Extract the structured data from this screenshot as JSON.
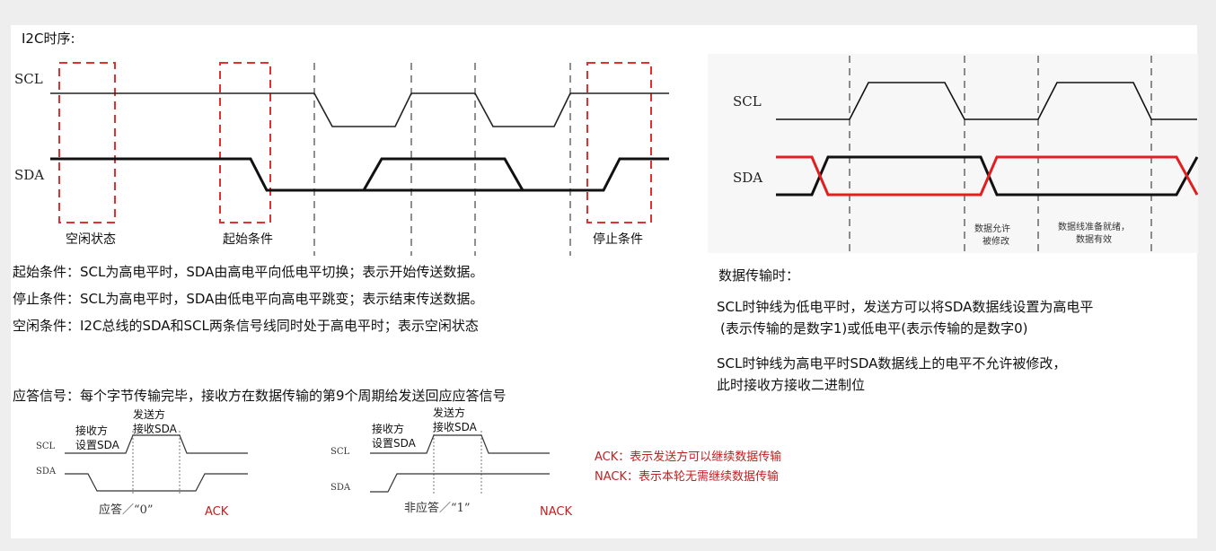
{
  "title": "I2C时序:",
  "main_diagram": {
    "scl_label": "SCL",
    "sda_label": "SDA",
    "idle_label": "空闲状态",
    "start_label": "起始条件",
    "stop_label": "停止条件",
    "colors": {
      "signal": "#222222",
      "highlight_box": "#e03030",
      "divider": "#444444"
    }
  },
  "descriptions": [
    "起始条件：SCL为高电平时，SDA由高电平向低电平切换；表示开始传送数据。",
    "停止条件：SCL为高电平时，SDA由低电平向高电平跳变；表示结束传送数据。",
    "空闲条件：I2C总线的SDA和SCL两条信号线同时处于高电平时；表示空闲状态"
  ],
  "transfer_diagram": {
    "scl_label": "SCL",
    "sda_label": "SDA",
    "note_modify_line1": "数据允许",
    "note_modify_line2": "被修改",
    "note_ready_line1": "数据线准备就绪，",
    "note_ready_line2": "数据有效",
    "colors": {
      "black": "#111111",
      "red": "#e02020"
    }
  },
  "transfer_text": {
    "heading": "数据传输时：",
    "para1_line1": "SCL时钟线为低电平时，发送方可以将SDA数据线设置为高电平",
    "para1_line2": "(表示传输的是数字1)或低电平(表示传输的是数字0)",
    "para2_line1": "SCL时钟线为高电平时SDA数据线上的电平不允许被修改，",
    "para2_line2": "此时接收方接收二进制位"
  },
  "ack_heading": "应答信号：每个字节传输完毕，接收方在数据传输的第9个周期给发送回应应答信号",
  "ack_diagram": {
    "scl_label": "SCL",
    "sda_label": "SDA",
    "receiver_line1": "接收方",
    "receiver_line2": "设置SDA",
    "sender_line1": "发送方",
    "sender_line2": "接收SDA",
    "caption": "应答／“0”",
    "tag": "ACK"
  },
  "nack_diagram": {
    "scl_label": "SCL",
    "sda_label": "SDA",
    "receiver_line1": "接收方",
    "receiver_line2": "设置SDA",
    "sender_line1": "发送方",
    "sender_line2": "接收SDA",
    "caption": "非应答／“1”",
    "tag": "NACK"
  },
  "legend": {
    "ack": "ACK：表示发送方可以继续数据传输",
    "nack": "NACK：表示本轮无需继续数据传输",
    "color": "#c02020"
  }
}
